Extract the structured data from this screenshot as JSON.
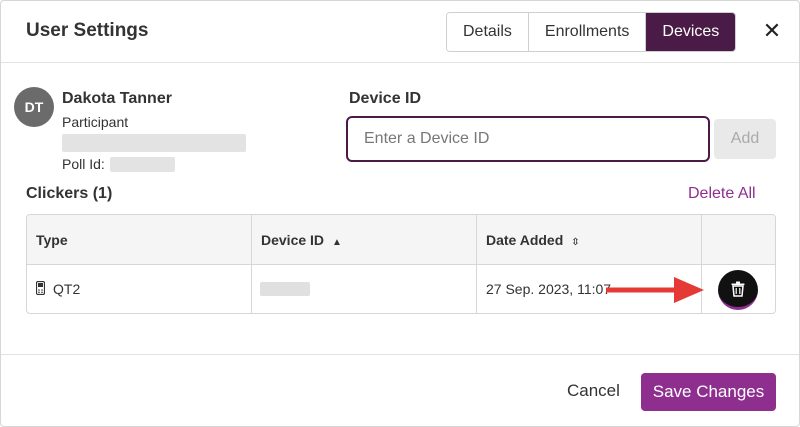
{
  "dialog": {
    "title": "User Settings",
    "close_glyph": "✕",
    "tabs": [
      {
        "label": "Details",
        "active": false
      },
      {
        "label": "Enrollments",
        "active": false
      },
      {
        "label": "Devices",
        "active": true
      }
    ]
  },
  "user": {
    "initials": "DT",
    "name": "Dakota Tanner",
    "role": "Participant",
    "poll_id_label": "Poll Id:"
  },
  "device_form": {
    "label": "Device ID",
    "placeholder": "Enter a Device ID",
    "value": "",
    "add_label": "Add"
  },
  "clickers": {
    "heading": "Clickers (1)",
    "delete_all_label": "Delete All",
    "columns": [
      {
        "label": "Type",
        "sort": "none"
      },
      {
        "label": "Device ID",
        "sort": "ascending"
      },
      {
        "label": "Date Added",
        "sort": "unsorted"
      },
      {
        "label": "",
        "sort": "none"
      }
    ],
    "rows": [
      {
        "type_icon": "clicker-device-icon",
        "type": "QT2",
        "date_added": "27 Sep. 2023, 11:07",
        "action_icon": "trash-icon"
      }
    ]
  },
  "annotation": {
    "arrow_color": "#e53935",
    "points_to": "delete-device-button"
  },
  "footer": {
    "cancel_label": "Cancel",
    "save_label": "Save Changes"
  },
  "colors": {
    "brand_dark": "#4a1b47",
    "brand_accent": "#8e2e8f"
  }
}
